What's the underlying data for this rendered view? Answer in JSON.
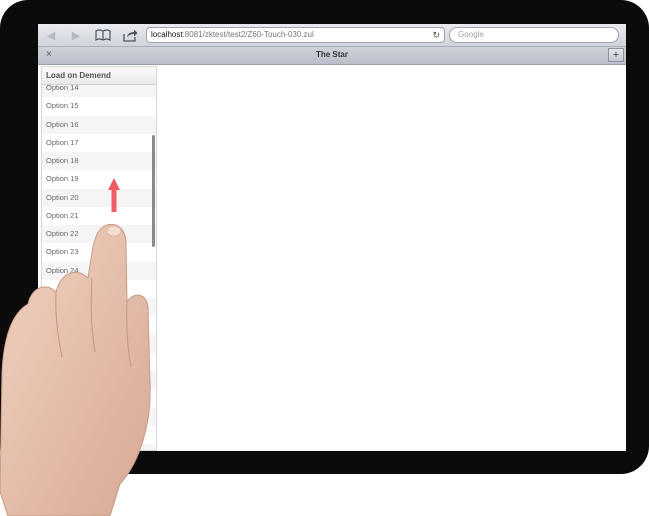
{
  "browser": {
    "back_icon": "back-arrow-icon",
    "forward_icon": "forward-arrow-icon",
    "bookmarks_icon": "open-book-icon",
    "share_icon": "share-icon",
    "url_host": "localhost",
    "url_path": ":8081/zktest/test2/Z60-Touch-030.zul",
    "reload_icon": "reload-icon",
    "search_placeholder": "Google"
  },
  "tab": {
    "close": "×",
    "title": "The Star",
    "add": "+"
  },
  "listbox": {
    "header": "Load on Demend",
    "items": [
      "Option 14",
      "Option 15",
      "Option 16",
      "Option 17",
      "Option 18",
      "Option 19",
      "Option 20",
      "Option 21",
      "Option 22",
      "Option 23",
      "Option 24",
      "",
      "",
      "",
      "",
      "",
      "",
      "",
      "",
      "",
      ""
    ]
  },
  "gesture": {
    "direction": "up",
    "arrow_color": "#f25c64",
    "icon": "swipe-up-arrow-icon"
  }
}
